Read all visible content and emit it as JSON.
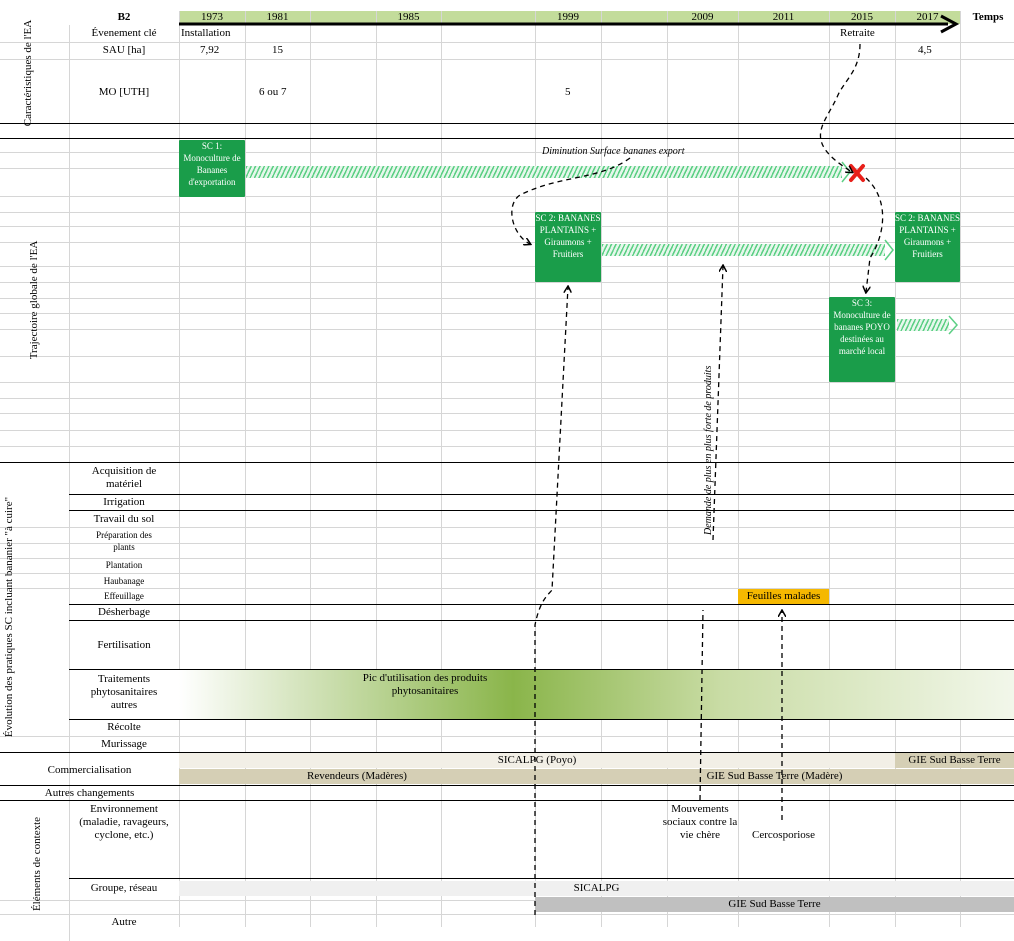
{
  "header": {
    "code": "B2",
    "temps": "Temps",
    "years": [
      "1973",
      "1981",
      "1985",
      "1999",
      "2009",
      "2011",
      "2015",
      "2017"
    ]
  },
  "groups": {
    "caracteristiques": "Caractéristiques de l'EA",
    "trajectoire": "Trajectoire globale de l'EA",
    "evolution": "Évolution des pratiques SC incluant bananier \"à cuire\"",
    "contexte": "Éléments de contexte"
  },
  "rows": {
    "evenement": "Évenement clé",
    "sau": "SAU [ha]",
    "mo": "MO [UTH]",
    "acquisition": "Acquisition de matériel",
    "irrigation": "Irrigation",
    "travail": "Travail du sol",
    "preparation": "Préparation des plants",
    "plantation": "Plantation",
    "haubanage": "Haubanage",
    "effeuillage": "Effeuillage",
    "desherbage": "Désherbage",
    "fertilisation": "Fertilisation",
    "traitements": "Traitements phytosanitaires autres",
    "recolte": "Récolte",
    "murissage": "Murissage",
    "commercialisation": "Commercialisation",
    "autres_changements": "Autres changements",
    "environnement": "Environnement (maladie, ravageurs, cyclone, etc.)",
    "groupe": "Groupe, réseau",
    "autre": "Autre"
  },
  "values": {
    "installation": "Installation",
    "retraite": "Retraite",
    "sau_1973": "7,92",
    "sau_1981": "15",
    "sau_2017": "4,5",
    "mo_1981": "6 ou 7",
    "mo_1999": "5"
  },
  "systems": {
    "sc1": "SC 1: Monoculture de Bananes d'exportation",
    "sc2": "SC 2: BANANES PLANTAINS + Giraumons + Fruitiers",
    "sc2b": "SC 2: BANANES PLANTAINS + Giraumons + Fruitiers",
    "sc3": "SC 3: Monoculture de bananes POYO destinées au marché local"
  },
  "annotations": {
    "diminution": "Diminution Surface bananes export",
    "demande": "Demande de plus en plus forte de produits",
    "feuilles": "Feuilles malades",
    "pic": "Pic d'utilisation des produits phytosanitaires",
    "mouvements": "Mouvements sociaux contre la vie chère",
    "cercosporiose": "Cercosporiose"
  },
  "commerce": {
    "sicalpg_poyo": "SICALPG (Poyo)",
    "gie_sud": "GIE Sud Basse Terre",
    "revendeurs": "Revendeurs (Madères)",
    "gie_madere": "GIE Sud Basse Terre (Madère)"
  },
  "reseau": {
    "sicalpg": "SICALPG",
    "gie": "GIE Sud Basse Terre"
  },
  "colors": {
    "green_box": "#1a9d4a",
    "header_green": "#c3dc9b",
    "orange": "#f5b800",
    "red_cross": "#e8201a",
    "beige": "#d5cfb5"
  }
}
